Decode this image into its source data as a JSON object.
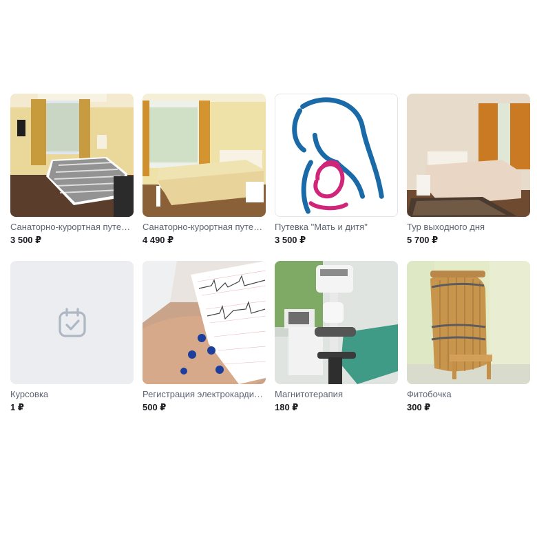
{
  "products": [
    {
      "title": "Санаторно-курортная путевка",
      "price": "3 500 ₽",
      "image": "room-twin-beds"
    },
    {
      "title": "Санаторно-курортная путевка",
      "price": "4 490 ₽",
      "image": "room-double-bed"
    },
    {
      "title": "Путевка \"Мать и дитя\"",
      "price": "3 500 ₽",
      "image": "mother-child-logo"
    },
    {
      "title": "Тур выходного дня",
      "price": "5 700 ₽",
      "image": "room-bed-rug"
    },
    {
      "title": "Курсовка",
      "price": "1 ₽",
      "image": "calendar-check-icon"
    },
    {
      "title": "Регистрация электрокардиограммы",
      "price": "500 ₽",
      "image": "ecg-procedure"
    },
    {
      "title": "Магнитотерапия",
      "price": "180 ₽",
      "image": "magnetotherapy-device"
    },
    {
      "title": "Фитобочка",
      "price": "300 ₽",
      "image": "wooden-barrel"
    }
  ],
  "colors": {
    "title": "#5d6473",
    "price": "#1b1d21",
    "placeholder_bg": "#ebedf0",
    "placeholder_icon": "#aeb7c2"
  }
}
